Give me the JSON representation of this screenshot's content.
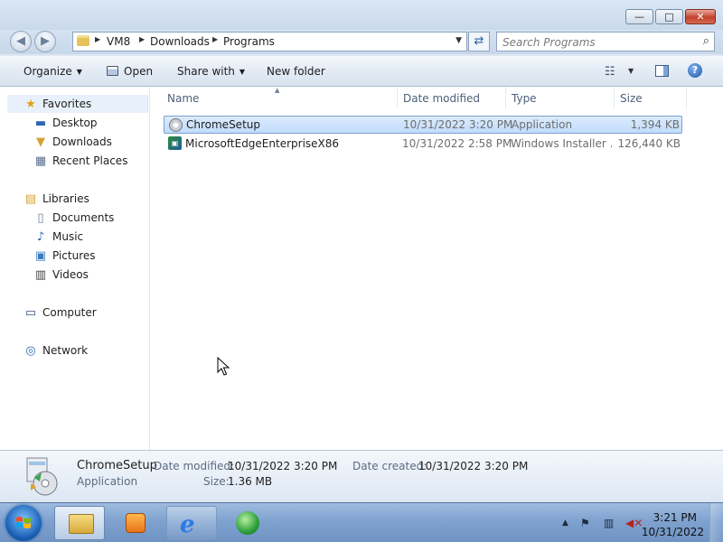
{
  "window": {
    "minimize_glyph": "—",
    "maximize_glyph": "□",
    "close_glyph": "✕"
  },
  "address": {
    "breadcrumbs": [
      "VM8",
      "Downloads",
      "Programs"
    ],
    "search_placeholder": "Search Programs"
  },
  "toolbar": {
    "organize": "Organize",
    "open": "Open",
    "share_with": "Share with",
    "new_folder": "New folder",
    "help_glyph": "?"
  },
  "nav": {
    "favorites": "Favorites",
    "desktop": "Desktop",
    "downloads": "Downloads",
    "recent_places": "Recent Places",
    "libraries": "Libraries",
    "documents": "Documents",
    "music": "Music",
    "pictures": "Pictures",
    "videos": "Videos",
    "computer": "Computer",
    "network": "Network"
  },
  "columns": {
    "name": "Name",
    "date_modified": "Date modified",
    "type": "Type",
    "size": "Size"
  },
  "files": [
    {
      "name": "ChromeSetup",
      "date_modified": "10/31/2022 3:20 PM",
      "type": "Application",
      "size": "1,394 KB",
      "selected": true
    },
    {
      "name": "MicrosoftEdgeEnterpriseX86",
      "date_modified": "10/31/2022 2:58 PM",
      "type": "Windows Installer ...",
      "size": "126,440 KB",
      "selected": false
    }
  ],
  "details": {
    "name": "ChromeSetup",
    "type": "Application",
    "date_modified_label": "Date modified:",
    "date_modified": "10/31/2022 3:20 PM",
    "date_created_label": "Date created:",
    "date_created": "10/31/2022 3:20 PM",
    "size_label": "Size:",
    "size": "1.36 MB"
  },
  "taskbar": {
    "time": "3:21 PM",
    "date": "10/31/2022"
  },
  "icons": {
    "favorites": "star-icon",
    "desktop": "desktop-icon",
    "downloads": "downloads-folder-icon",
    "recent_places": "recent-places-icon",
    "libraries": "libraries-icon",
    "documents": "documents-icon",
    "music": "music-icon",
    "pictures": "pictures-icon",
    "videos": "videos-icon",
    "computer": "computer-icon",
    "network": "network-icon"
  },
  "colors": {
    "selection": "#c1dcfc",
    "selection_border": "#7da2ce",
    "accent_blue": "#2d63a8",
    "close_red": "#c4412b"
  }
}
